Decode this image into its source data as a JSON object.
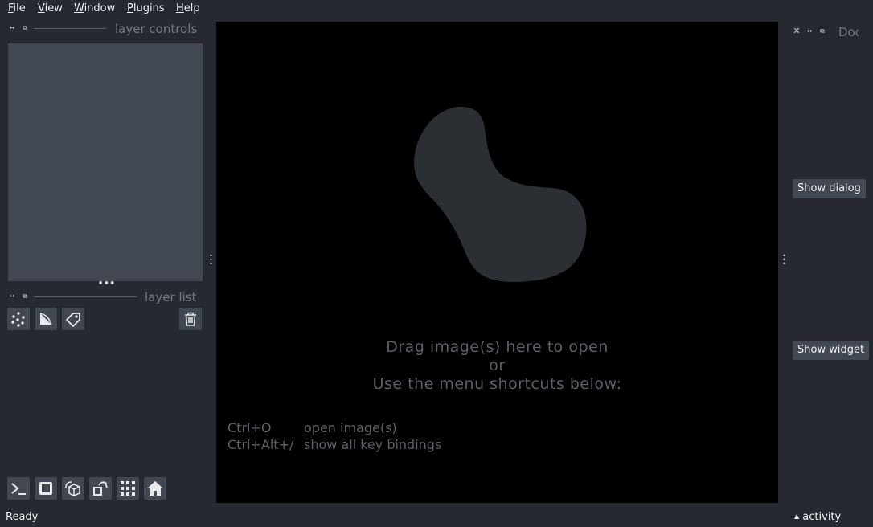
{
  "menu": {
    "items": [
      {
        "id": "file",
        "underline": "F",
        "rest": "ile"
      },
      {
        "id": "view",
        "underline": "V",
        "rest": "iew"
      },
      {
        "id": "window",
        "underline": "W",
        "rest": "indow"
      },
      {
        "id": "plugins",
        "underline": "P",
        "rest": "lugins"
      },
      {
        "id": "help",
        "underline": "H",
        "rest": "elp"
      }
    ]
  },
  "left_dock": {
    "layer_controls_title": "layer controls",
    "layer_list_title": "layer list"
  },
  "layer_buttons": {
    "icons": [
      "new-points-layer-icon",
      "new-shapes-layer-icon",
      "new-labels-layer-icon",
      "delete-layer-icon"
    ]
  },
  "viewer_buttons": {
    "icons": [
      "console-icon",
      "ndisplay-icon",
      "roll-icon",
      "transpose-icon",
      "grid-icon",
      "home-icon"
    ]
  },
  "canvas": {
    "line1": "Drag image(s) here to open",
    "line2": "or",
    "line3": "Use the menu shortcuts below:",
    "shortcuts": [
      {
        "keys": "Ctrl+O",
        "desc": "open image(s)"
      },
      {
        "keys": "Ctrl+Alt+/",
        "desc": "show all key bindings"
      }
    ]
  },
  "right_dock": {
    "title": "Doc",
    "show_dialog_label": "Show dialog",
    "show_widget_label": "Show widget"
  },
  "status": {
    "text": "Ready",
    "activity_label": "activity"
  },
  "colors": {
    "background": "#262930",
    "panel": "#414851",
    "canvas": "#000000",
    "logo": "#2b2e33"
  }
}
